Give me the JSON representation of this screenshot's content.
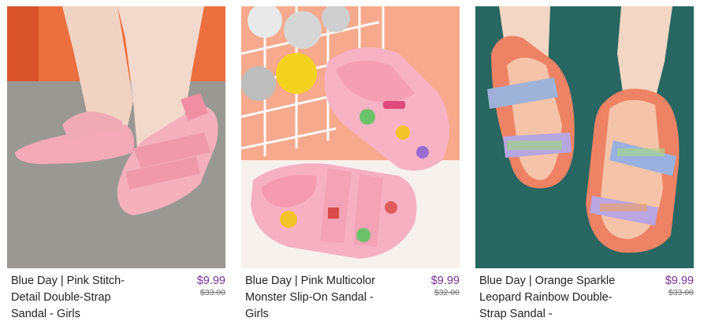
{
  "products": [
    {
      "title": "Blue Day | Pink Stitch-Detail Double-Strap Sandal - Girls",
      "price": "$9.99",
      "original_price": "$33.00",
      "image_icon": "pink-sandal-photo"
    },
    {
      "title": "Blue Day | Pink Multicolor Monster Slip-On Sandal - Girls",
      "price": "$9.99",
      "original_price": "$32.00",
      "image_icon": "monster-slide-photo"
    },
    {
      "title": "Blue Day | Orange Sparkle Leopard Rainbow Double-Strap Sandal -",
      "price": "$9.99",
      "original_price": "$33.00",
      "image_icon": "orange-sandal-photo"
    }
  ],
  "colors": {
    "price": "#7a2e96",
    "title": "#222222",
    "msrp": "#6d6d6d"
  }
}
